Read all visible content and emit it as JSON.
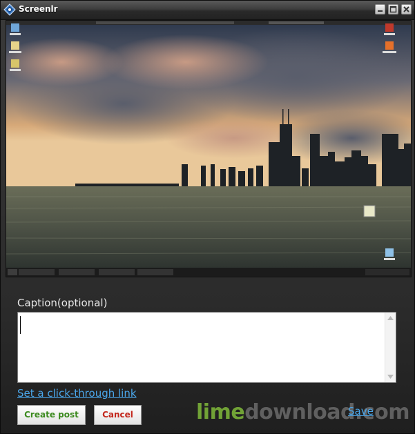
{
  "window": {
    "title": "Screenlr",
    "controls": [
      "minimize-icon",
      "maximize-icon",
      "close-icon"
    ]
  },
  "preview": {
    "description_icon": "screenshot-preview",
    "taskbar_items": [
      "",
      "",
      "",
      ""
    ]
  },
  "caption": {
    "label": "Caption(optional)",
    "value": "",
    "placeholder": ""
  },
  "links": {
    "click_through": "Set a click-through link",
    "save": "Save"
  },
  "buttons": {
    "create_post": "Create post",
    "cancel": "Cancel"
  },
  "watermark": {
    "part1": "lime",
    "part2": "download.com"
  },
  "colors": {
    "create_post_text": "#3b8a1e",
    "cancel_text": "#c3261b",
    "link": "#4aa6ea",
    "watermark_green": "#7fb93a"
  }
}
